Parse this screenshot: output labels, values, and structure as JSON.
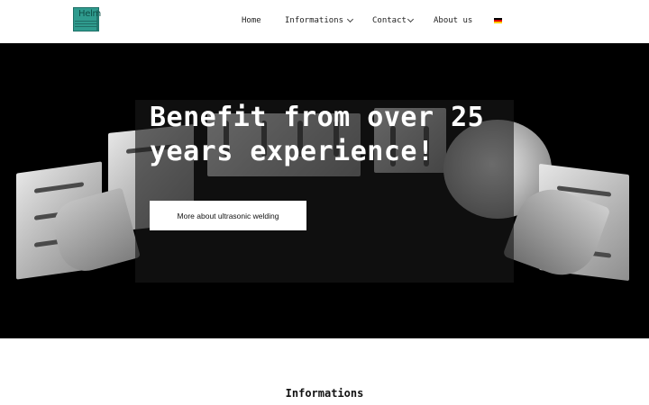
{
  "header": {
    "logo_text": "Helm",
    "nav": {
      "home": "Home",
      "informations": "Informations",
      "contact": "Contact",
      "about": "About us"
    },
    "flag_colors": [
      "#000000",
      "#dd0000",
      "#ffce00"
    ]
  },
  "hero": {
    "title": "Benefit from over 25 years experience!",
    "button_label": "More about ultrasonic welding",
    "background_color": "#000000"
  },
  "section": {
    "title": "Informations"
  }
}
